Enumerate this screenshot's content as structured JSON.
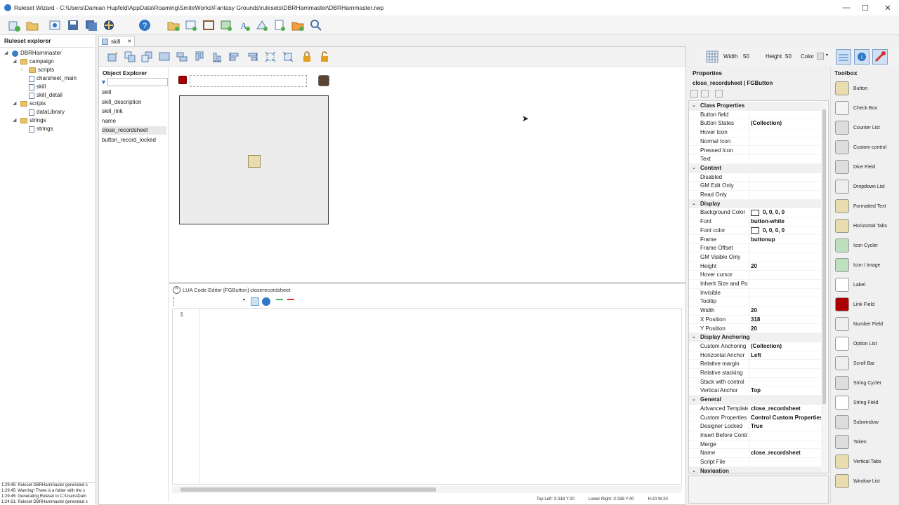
{
  "window": {
    "title": "Ruleset Wizard - C:\\Users\\Damian Hupfeld\\AppData\\Roaming\\SmiteWorks\\Fantasy Grounds\\rulesets\\DBRHarnmaster\\DBRHarnmaster.rwp",
    "min": "—",
    "max": "☐",
    "close": "✕"
  },
  "colors": {
    "accent": "#2f77c8",
    "folder": "#e8c36a"
  },
  "ruleset_explorer": {
    "title": "Ruleset explorer",
    "items": [
      {
        "label": "DBRHarnmaster",
        "icon": "globe-icon"
      },
      {
        "label": "campaign",
        "icon": "folder-icon"
      },
      {
        "label": "scripts",
        "icon": "folder-icon"
      },
      {
        "label": "charsheet_main",
        "icon": "window-icon"
      },
      {
        "label": "skill",
        "icon": "window-icon"
      },
      {
        "label": "skill_detail",
        "icon": "window-icon"
      },
      {
        "label": "scripts",
        "icon": "folder-icon"
      },
      {
        "label": "dataLibrary",
        "icon": "file-icon"
      },
      {
        "label": "strings",
        "icon": "folder-icon"
      },
      {
        "label": "strings",
        "icon": "file-icon"
      }
    ]
  },
  "log": [
    "1:29:45: Ruleset DBRHarnmaster generated s",
    "1:29:45: Warning! There is a folder with the s",
    "1:29:45: Generating Ruleset to C:\\Users\\Dam",
    "1:24:51: Ruleset DBRHarnmaster generated s"
  ],
  "doc_tab": {
    "label": "skill",
    "close": "✕"
  },
  "object_explorer": {
    "title": "Object Explorer",
    "items": [
      "skill",
      "skill_description",
      "skill_link",
      "name",
      "close_recordsheet",
      "button_record_locked"
    ]
  },
  "lua": {
    "title": "LUA Code Editor [FGButton] closerecordsheet",
    "line_number": "1"
  },
  "grid": {
    "width_label": "Width",
    "width": "50",
    "height_label": "Height",
    "height": "50",
    "color_label": "Color"
  },
  "properties": {
    "title": "Properties",
    "subtitle": "close_recordsheet | FGButton",
    "rows": [
      {
        "cat": true,
        "name": "Class Properties"
      },
      {
        "name": "Button field",
        "value": ""
      },
      {
        "name": "Button States",
        "value": "(Collection)"
      },
      {
        "name": "Hover Icon",
        "value": ""
      },
      {
        "name": "Normal Icon",
        "value": ""
      },
      {
        "name": "Pressed Icon",
        "value": ""
      },
      {
        "name": "Text",
        "value": ""
      },
      {
        "cat": true,
        "name": "Content"
      },
      {
        "name": "Disabled",
        "value": ""
      },
      {
        "name": "GM Edit Only",
        "value": ""
      },
      {
        "name": "Read Only",
        "value": ""
      },
      {
        "cat": true,
        "name": "Display"
      },
      {
        "name": "Background Color",
        "value": "0, 0, 0, 0",
        "swatch": true
      },
      {
        "name": "Font",
        "value": "button-white"
      },
      {
        "name": "Font color",
        "value": "0, 0, 0, 0",
        "swatch": true
      },
      {
        "name": "Frame",
        "value": "buttonup"
      },
      {
        "name": "Frame Offset",
        "value": ""
      },
      {
        "name": "GM Visible Only",
        "value": ""
      },
      {
        "name": "Height",
        "value": "20"
      },
      {
        "name": "Hover cursor",
        "value": ""
      },
      {
        "name": "Inherit Size and Pos",
        "value": ""
      },
      {
        "name": "Invisible",
        "value": ""
      },
      {
        "name": "Tooltip",
        "value": ""
      },
      {
        "name": "Width",
        "value": "20"
      },
      {
        "name": "X Position",
        "value": "318"
      },
      {
        "name": "Y Position",
        "value": "20"
      },
      {
        "cat": true,
        "name": "Display Anchoring"
      },
      {
        "name": "Custom Anchoring",
        "value": "(Collection)"
      },
      {
        "name": "Horizontal Anchor",
        "value": "Left"
      },
      {
        "name": "Relative margin",
        "value": ""
      },
      {
        "name": "Relative stacking",
        "value": ""
      },
      {
        "name": "Stack with control",
        "value": ""
      },
      {
        "name": "Vertical Anchor",
        "value": "Top"
      },
      {
        "cat": true,
        "name": "General"
      },
      {
        "name": "Advanced Template",
        "value": "close_recordsheet"
      },
      {
        "name": "Custom Properties",
        "value": "Control Custom Properties"
      },
      {
        "name": "Designer Locked",
        "value": "True"
      },
      {
        "name": "Insert Before Contro",
        "value": ""
      },
      {
        "name": "Merge",
        "value": ""
      },
      {
        "name": "Name",
        "value": "close_recordsheet"
      },
      {
        "name": "Script File",
        "value": ""
      },
      {
        "cat": true,
        "name": "Navigation"
      }
    ]
  },
  "toolbox": {
    "title": "Toolbox",
    "items": [
      "Button",
      "Check Box",
      "Counter List",
      "Custom control",
      "Dice Field",
      "Dropdown List",
      "Formatted Text",
      "Horizontal Tabs",
      "Icon Cycler",
      "Icon / Image",
      "Label",
      "Link Field",
      "Number Field",
      "Option List",
      "Scroll Bar",
      "String Cycler",
      "String Field",
      "Subwindow",
      "Token",
      "Vertical Tabs",
      "Window List"
    ]
  },
  "status": {
    "top_left": "Top Left: X:318   Y:20",
    "lower_right": "Lower Right: X:338   Y:40",
    "size": "H:20  W:20"
  }
}
